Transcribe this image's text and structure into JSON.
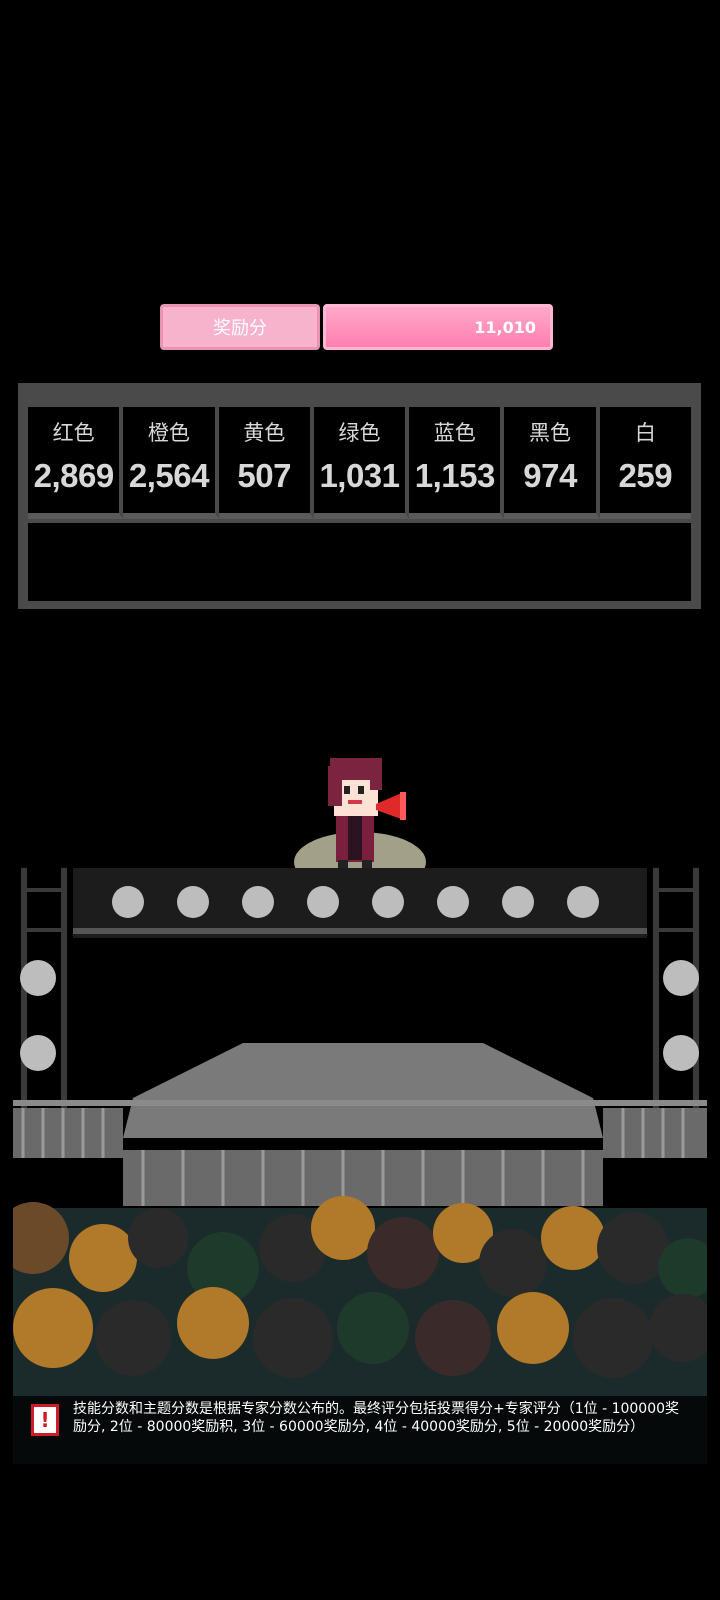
{
  "bonus": {
    "label": "奖励分",
    "value": "11,010"
  },
  "colors": {
    "bonus_label_bg": "#f7b3cc",
    "bonus_value_bg": "#ff8fbb",
    "panel_border": "#4a4a4a",
    "info_icon_red": "#cc1f2a"
  },
  "scores": [
    {
      "name": "红色",
      "value": "2,869"
    },
    {
      "name": "橙色",
      "value": "2,564"
    },
    {
      "name": "黄色",
      "value": "507"
    },
    {
      "name": "绿色",
      "value": "1,031"
    },
    {
      "name": "蓝色",
      "value": "1,153"
    },
    {
      "name": "黑色",
      "value": "974"
    },
    {
      "name": "白",
      "value": "259"
    }
  ],
  "character": {
    "icon": "singer-with-megaphone-icon"
  },
  "info": {
    "icon": "info-icon",
    "icon_glyph": "!",
    "text": "技能分数和主题分数是根据专家分数公布的。最终评分包括投票得分+专家评分（1位 - 100000奖励分, 2位 -  80000奖励积, 3位 -  60000奖励分, 4位 -  40000奖励分, 5位 - 20000奖励分）"
  }
}
